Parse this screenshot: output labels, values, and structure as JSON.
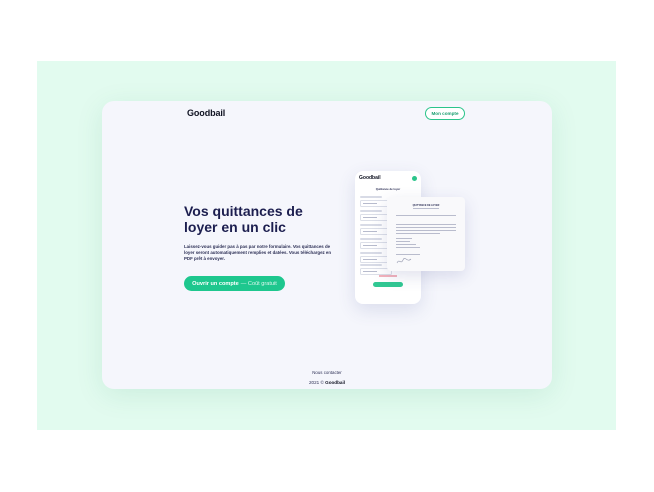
{
  "header": {
    "brand": "Goodbail",
    "account_button": "Mon compte"
  },
  "hero": {
    "title": "Vos quittances de loyer en un clic",
    "description": "Laissez-vous guider pas à pas par notre formulaire. Vos quittances de loyer seront automatiquement remplies et datées. Vous téléchargez en PDF prêt à envoyer.",
    "cta_main": "Ouvrir un compte",
    "cta_sub": "— Coût gratuit"
  },
  "mockup": {
    "phone_brand": "Goodbail",
    "phone_title": "Quittance de loyer",
    "doc_heading": "QUITTANCE DE LOYER"
  },
  "footer": {
    "contact": "Nous contacter",
    "copyright_prefix": "2021 ©",
    "copyright_brand": "Goodbail"
  },
  "colors": {
    "accent": "#1ec78e",
    "title": "#1c1e4f",
    "background": "#e2fbef"
  }
}
